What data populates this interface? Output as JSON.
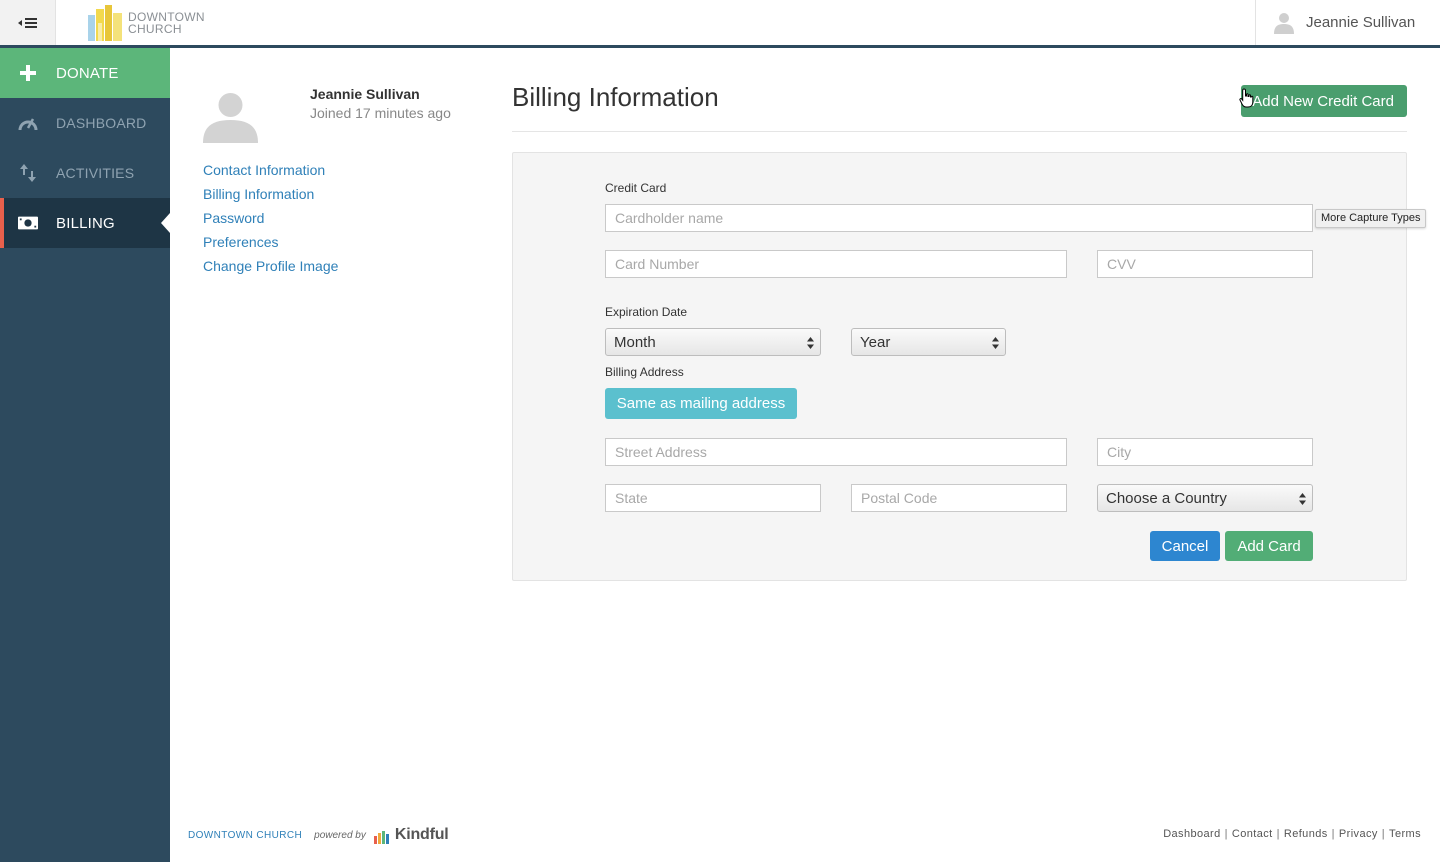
{
  "header": {
    "logo_line1": "DOWNTOWN",
    "logo_line2": "CHURCH",
    "user_name": "Jeannie Sullivan"
  },
  "sidebar": {
    "items": [
      {
        "label": "DONATE",
        "icon": "plus-icon"
      },
      {
        "label": "DASHBOARD",
        "icon": "gauge-icon"
      },
      {
        "label": "ACTIVITIES",
        "icon": "transfer-arrows-icon"
      },
      {
        "label": "BILLING",
        "icon": "money-icon"
      }
    ],
    "active": "BILLING"
  },
  "profile": {
    "name": "Jeannie Sullivan",
    "joined": "Joined 17 minutes ago",
    "links": [
      "Contact Information",
      "Billing Information",
      "Password",
      "Preferences",
      "Change Profile Image"
    ]
  },
  "main": {
    "title": "Billing Information",
    "add_button": "Add New Credit Card",
    "tooltip": "More Capture Types"
  },
  "form": {
    "credit_card_label": "Credit Card",
    "cardholder_placeholder": "Cardholder name",
    "card_number_placeholder": "Card Number",
    "cvv_placeholder": "CVV",
    "expiration_label": "Expiration Date",
    "month_value": "Month",
    "year_value": "Year",
    "billing_address_label": "Billing Address",
    "same_as_mailing": "Same as mailing address",
    "street_placeholder": "Street Address",
    "city_placeholder": "City",
    "state_placeholder": "State",
    "postal_placeholder": "Postal Code",
    "country_value": "Choose a Country",
    "cancel": "Cancel",
    "add_card": "Add Card"
  },
  "footer": {
    "org": "DOWNTOWN CHURCH",
    "powered_by": "powered by",
    "brand": "Kindful",
    "links": [
      "Dashboard",
      "Contact",
      "Refunds",
      "Privacy",
      "Terms"
    ]
  },
  "colors": {
    "sidebar_bg": "#2d4a5e",
    "donate_green": "#5cb67a",
    "active_accent": "#e8604c",
    "link_blue": "#2f80b8",
    "primary_blue": "#2d86d0",
    "success_green": "#52ad76",
    "info_teal": "#5bc0ce"
  }
}
